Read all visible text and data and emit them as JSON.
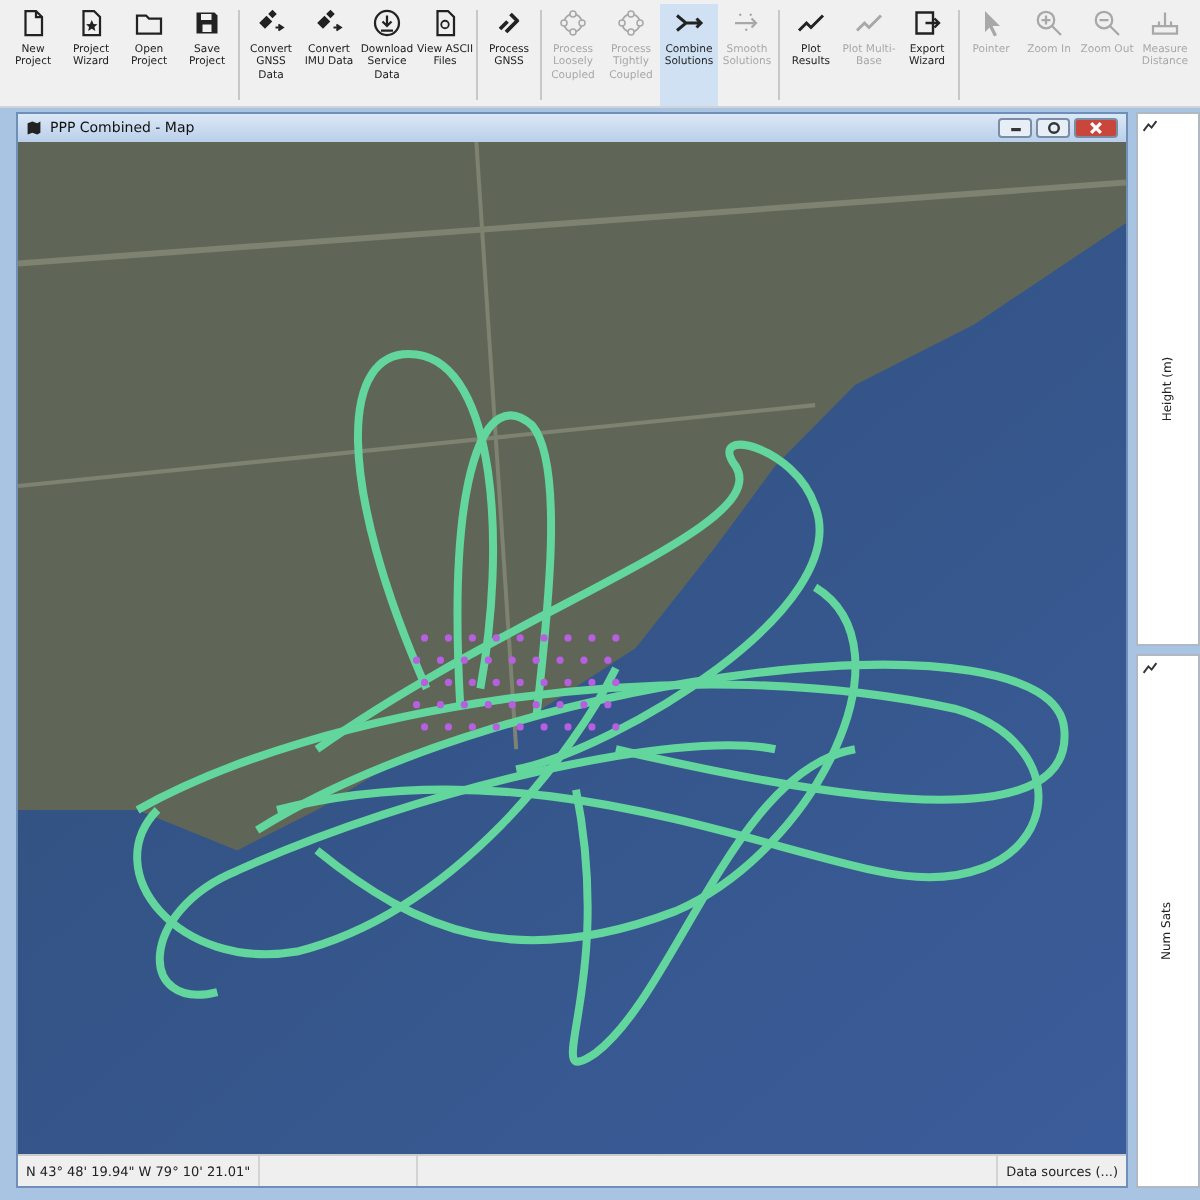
{
  "toolbar": {
    "groups": [
      {
        "buttons": [
          {
            "label": "New Project",
            "disabled": false,
            "selected": false
          },
          {
            "label": "Project Wizard",
            "disabled": false,
            "selected": false
          },
          {
            "label": "Open Project",
            "disabled": false,
            "selected": false
          },
          {
            "label": "Save Project",
            "disabled": false,
            "selected": false
          }
        ]
      },
      {
        "buttons": [
          {
            "label": "Convert GNSS Data",
            "disabled": false,
            "selected": false
          },
          {
            "label": "Convert IMU Data",
            "disabled": false,
            "selected": false
          },
          {
            "label": "Download Service Data",
            "disabled": false,
            "selected": false
          },
          {
            "label": "View ASCII Files",
            "disabled": false,
            "selected": false
          }
        ]
      },
      {
        "buttons": [
          {
            "label": "Process GNSS",
            "disabled": false,
            "selected": false
          }
        ]
      },
      {
        "buttons": [
          {
            "label": "Process Loosely Coupled",
            "disabled": true,
            "selected": false
          },
          {
            "label": "Process Tightly Coupled",
            "disabled": true,
            "selected": false
          },
          {
            "label": "Combine Solutions",
            "disabled": false,
            "selected": true
          },
          {
            "label": "Smooth Solutions",
            "disabled": true,
            "selected": false
          }
        ]
      },
      {
        "buttons": [
          {
            "label": "Plot Results",
            "disabled": false,
            "selected": false
          },
          {
            "label": "Plot Multi-Base",
            "disabled": true,
            "selected": false
          },
          {
            "label": "Export Wizard",
            "disabled": false,
            "selected": false
          }
        ]
      },
      {
        "buttons": [
          {
            "label": "Pointer",
            "disabled": true,
            "selected": false
          },
          {
            "label": "Zoom In",
            "disabled": true,
            "selected": false
          },
          {
            "label": "Zoom Out",
            "disabled": true,
            "selected": false
          },
          {
            "label": "Measure Distance",
            "disabled": true,
            "selected": false
          }
        ]
      }
    ]
  },
  "map_window": {
    "title": "PPP Combined - Map",
    "status_bar": {
      "coordinates": "N 43° 48' 19.94\"   W 79° 10' 21.01\"",
      "data_sources": "Data sources (...)"
    }
  },
  "side_panels": [
    {
      "axis_label": "Height (m)"
    },
    {
      "axis_label": "Num Sats"
    }
  ]
}
